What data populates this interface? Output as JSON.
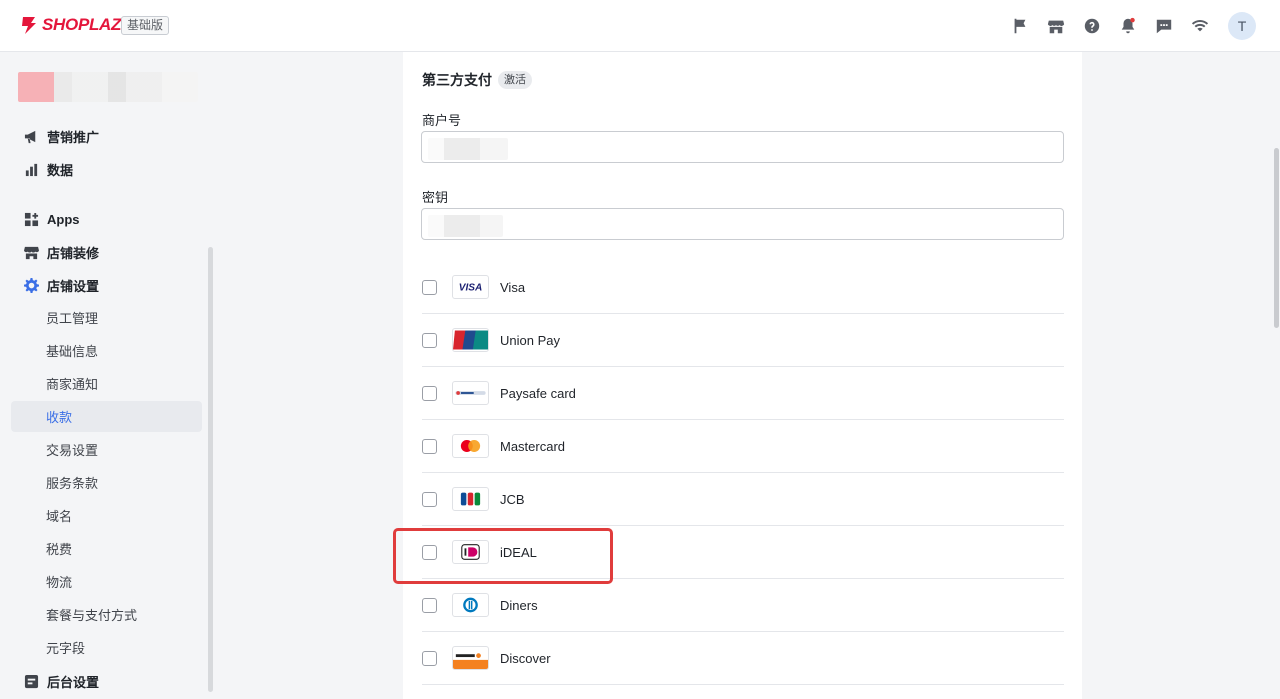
{
  "app": {
    "brand": "SHOPLAZZA",
    "plan": "基础版",
    "avatar_letter": "T"
  },
  "sidebar": {
    "items": [
      {
        "label": "营销推广",
        "icon": "megaphone-icon"
      },
      {
        "label": "数据",
        "icon": "bar-chart-icon"
      },
      {
        "label": "Apps",
        "icon": "apps-icon"
      },
      {
        "label": "店铺装修",
        "icon": "store-icon"
      },
      {
        "label": "店铺设置",
        "icon": "gear-icon"
      },
      {
        "label": "后台设置",
        "icon": "admin-icon"
      }
    ],
    "sub_items": [
      "员工管理",
      "基础信息",
      "商家通知",
      "收款",
      "交易设置",
      "服务条款",
      "域名",
      "税费",
      "物流",
      "套餐与支付方式",
      "元字段"
    ],
    "selected_sub": "收款"
  },
  "payment": {
    "title": "第三方支付",
    "status": "激活",
    "merchant_label": "商户号",
    "secret_label": "密钥",
    "methods": [
      "Visa",
      "Union Pay",
      "Paysafe card",
      "Mastercard",
      "JCB",
      "iDEAL",
      "Diners",
      "Discover"
    ]
  },
  "colors": {
    "brand": "#e4163b",
    "accent": "#3b6fe6",
    "highlight": "#e03c3c"
  }
}
